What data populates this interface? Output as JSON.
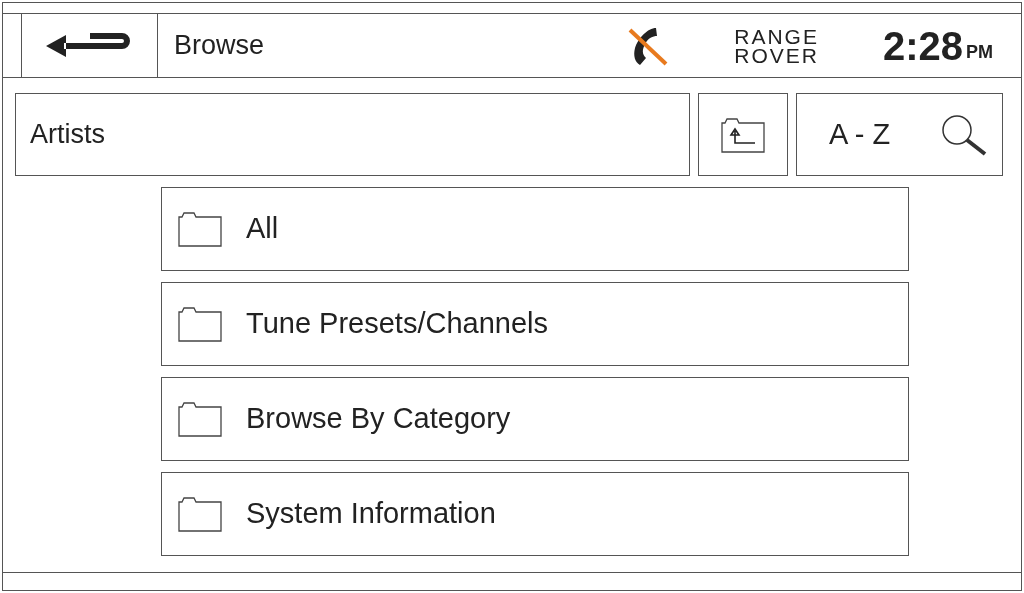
{
  "header": {
    "title": "Browse",
    "logo": [
      "RANGE",
      "ROVER"
    ],
    "time": "2:28",
    "meridiem": "PM"
  },
  "toolbar": {
    "category": "Artists",
    "az_label": "A - Z"
  },
  "items": [
    {
      "label": "All"
    },
    {
      "label": "Tune Presets/Channels"
    },
    {
      "label": "Browse By Category"
    },
    {
      "label": "System Information"
    }
  ]
}
